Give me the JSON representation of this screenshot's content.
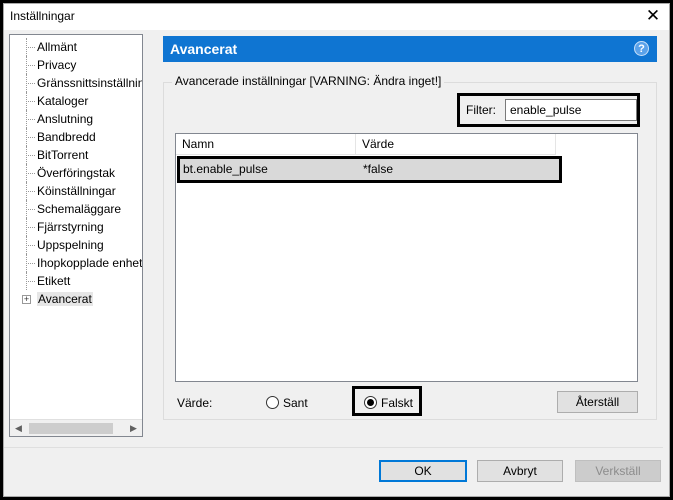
{
  "window": {
    "title": "Inställningar"
  },
  "sidebar": {
    "items": [
      {
        "label": "Allmänt"
      },
      {
        "label": "Privacy"
      },
      {
        "label": "Gränssnittsinställningar"
      },
      {
        "label": "Kataloger"
      },
      {
        "label": "Anslutning"
      },
      {
        "label": "Bandbredd"
      },
      {
        "label": "BitTorrent"
      },
      {
        "label": "Överföringstak"
      },
      {
        "label": "Köinställningar"
      },
      {
        "label": "Schemaläggare"
      },
      {
        "label": "Fjärrstyrning"
      },
      {
        "label": "Uppspelning"
      },
      {
        "label": "Ihopkopplade enheter"
      },
      {
        "label": "Etikett"
      },
      {
        "label": "Avancerat",
        "selected": true
      }
    ]
  },
  "main": {
    "header": "Avancerat",
    "group_label": "Avancerade inställningar [VARNING: Ändra inget!]",
    "filter_label": "Filter:",
    "filter_value": "enable_pulse",
    "columns": {
      "name": "Namn",
      "value": "Värde"
    },
    "rows": [
      {
        "name": "bt.enable_pulse",
        "value": "*false"
      }
    ],
    "value_label": "Värde:",
    "radio_true": "Sant",
    "radio_false": "Falskt",
    "selected_radio": "false",
    "reset_button": "Återställ"
  },
  "footer": {
    "ok": "OK",
    "cancel": "Avbryt",
    "apply": "Verkställ"
  },
  "colors": {
    "accent": "#0f75d2"
  }
}
